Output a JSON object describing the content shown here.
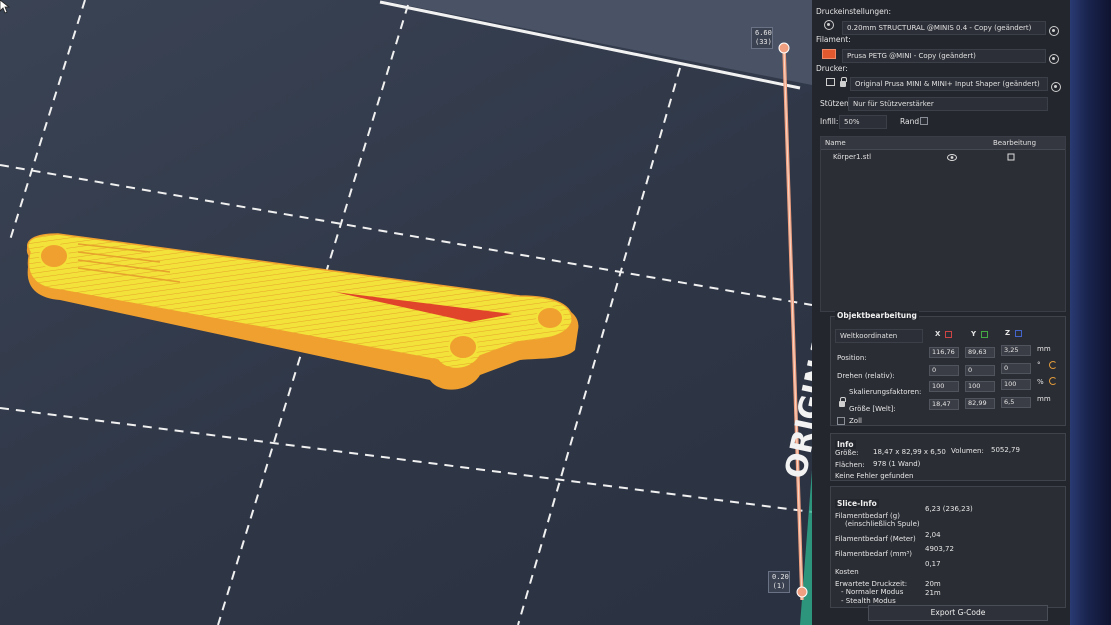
{
  "viewport": {
    "layer_top_height": "6.60",
    "layer_top_index": "(33)",
    "layer_bottom_height": "0.20",
    "layer_bottom_index": "(1)",
    "bed_label": "ORIGINA"
  },
  "colors": {
    "model_yellow": "#f2e23a",
    "model_orange": "#f0a02e",
    "model_red": "#e0442a",
    "slider_line": "#f0a080",
    "bed_edge": "#f2f2f2",
    "accent_teal": "#2fae8c"
  },
  "print_settings": {
    "label": "Druckeinstellungen:",
    "value": "0.20mm STRUCTURAL @MINIS 0.4 - Copy (geändert)"
  },
  "filament": {
    "label": "Filament:",
    "value": "Prusa PETG @MINI - Copy (geändert)"
  },
  "printer": {
    "label": "Drucker:",
    "value": "Original Prusa MINI & MINI+ Input Shaper (geändert)"
  },
  "supports": {
    "label": "Stützen:",
    "value": "Nur für Stützverstärker"
  },
  "infill": {
    "label": "Infill:",
    "value": "50%"
  },
  "brim": {
    "label": "Rand:"
  },
  "object_list": {
    "col_name": "Name",
    "col_edit": "Bearbeitung",
    "rows": [
      {
        "name": "Körper1.stl"
      }
    ]
  },
  "object_edit": {
    "title": "Objektbearbeitung",
    "coord_system": "Weltkoordinaten",
    "axis_x": "X",
    "axis_y": "Y",
    "axis_z": "Z",
    "position_label": "Position:",
    "position": [
      "116,76",
      "89,63",
      "3,25"
    ],
    "position_unit": "mm",
    "rotate_label": "Drehen (relativ):",
    "rotate": [
      "0",
      "0",
      "0"
    ],
    "rotate_unit": "°",
    "scale_label": "Skalierungsfaktoren:",
    "scale": [
      "100",
      "100",
      "100"
    ],
    "scale_unit": "%",
    "size_label": "Größe [Welt]:",
    "size": [
      "18,47",
      "82,99",
      "6,5"
    ],
    "size_unit": "mm",
    "inch_label": "Zoll"
  },
  "info": {
    "title": "Info",
    "size_label": "Größe:",
    "size_value": "18,47 x 82,99 x 6,50",
    "volume_label": "Volumen:",
    "volume_value": "5052,79",
    "facets_label": "Flächen:",
    "facets_value": "978 (1 Wand)",
    "errors": "Keine Fehler gefunden"
  },
  "slice_info": {
    "title": "Slice-Info",
    "filament_g_label": "Filamentbedarf (g)",
    "filament_g_sub": "(einschließlich Spule)",
    "filament_g_value": "6,23 (236,23)",
    "filament_m_label": "Filamentbedarf (Meter)",
    "filament_m_value": "2,04",
    "filament_mm3_label": "Filamentbedarf (mm³)",
    "filament_mm3_value": "4903,72",
    "cost_label": "Kosten",
    "cost_value": "0,17",
    "time_label": "Erwartete Druckzeit:",
    "normal_label": "- Normaler Modus",
    "normal_value": "20m",
    "stealth_label": "- Stealth Modus",
    "stealth_value": "21m"
  },
  "export_button": "Export G-Code"
}
